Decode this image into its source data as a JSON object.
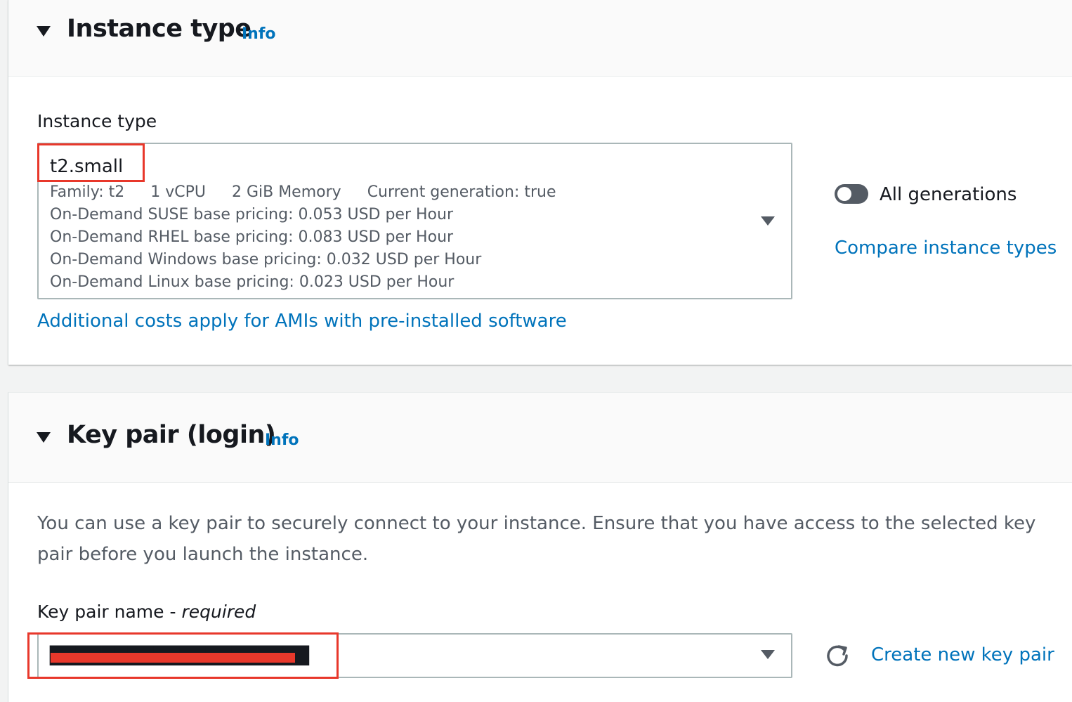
{
  "instance_type_section": {
    "title": "Instance type",
    "info_label": "Info",
    "field_label": "Instance type",
    "selected": {
      "name": "t2.small",
      "family": "Family: t2",
      "vcpu": "1 vCPU",
      "memory": "2 GiB Memory",
      "current_generation": "Current generation: true",
      "pricing": [
        "On-Demand SUSE base pricing: 0.053 USD per Hour",
        "On-Demand RHEL base pricing: 0.083 USD per Hour",
        "On-Demand Windows base pricing: 0.032 USD per Hour",
        "On-Demand Linux base pricing: 0.023 USD per Hour"
      ]
    },
    "toggle_label": "All generations",
    "toggle_on": false,
    "compare_link": "Compare instance types",
    "additional_costs_link": "Additional costs apply for AMIs with pre-installed software"
  },
  "key_pair_section": {
    "title": "Key pair (login)",
    "info_label": "Info",
    "description": "You can use a key pair to securely connect to your instance. Ensure that you have access to the selected key pair before you launch the instance.",
    "field_label": "Key pair name -",
    "field_required": "required",
    "create_link": "Create new key pair"
  },
  "colors": {
    "link": "#0073bb",
    "annotation_red": "#e8382b",
    "toggle_off": "#545b64"
  },
  "icons": [
    "caret-down-icon",
    "dropdown-arrow-icon",
    "refresh-icon"
  ]
}
